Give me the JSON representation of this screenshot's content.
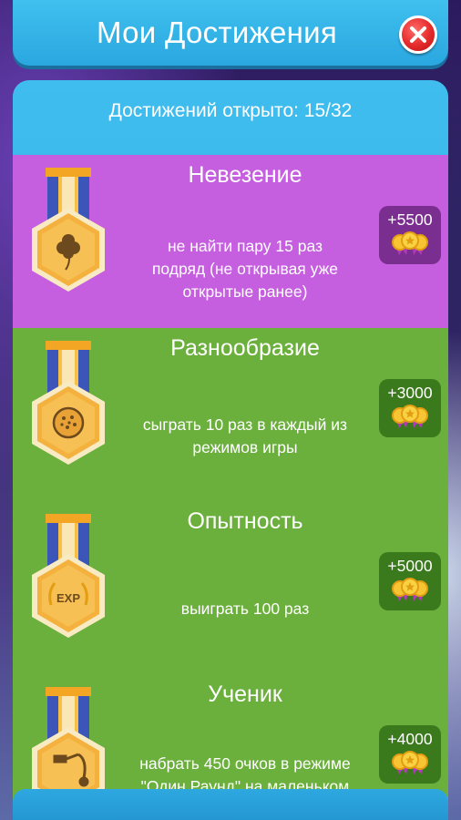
{
  "header": {
    "title": "Мои Достижения",
    "close_icon": "close-icon"
  },
  "counter": {
    "label": "Достижений открыто: 15/32"
  },
  "colors": {
    "purple_card": "#c65ee0",
    "green_card": "#6bb03c",
    "panel": "#2ba6df",
    "close": "#e52a2a"
  },
  "achievements": [
    {
      "title": "Невезение",
      "desc_lines": [
        "не найти пару 15 раз",
        "подряд (не открывая уже",
        "открытые ранее)"
      ],
      "reward": "+5500",
      "icon": "clover-icon",
      "color": "purple"
    },
    {
      "title": "Разнообразие",
      "desc_lines": [
        "сыграть 10 раз в каждый из",
        "режимов игры"
      ],
      "reward": "+3000",
      "icon": "cookie-icon",
      "color": "green"
    },
    {
      "title": "Опытность",
      "desc_lines": [
        "выиграть 100 раз"
      ],
      "reward": "+5000",
      "icon": "exp-icon",
      "icon_text": "EXP",
      "color": "green"
    },
    {
      "title": "Ученик",
      "desc_lines": [
        "набрать 450 очков в режиме",
        "\"Один Раунд\" на маленьком"
      ],
      "reward": "+4000",
      "icon": "shower-icon",
      "color": "green"
    }
  ]
}
